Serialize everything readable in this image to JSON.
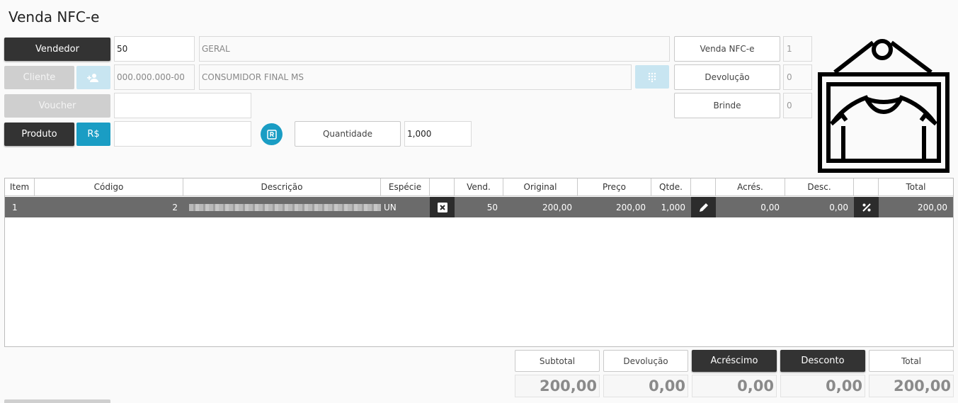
{
  "page": {
    "title": "Venda NFC-e"
  },
  "form": {
    "vendedor_label": "Vendedor",
    "vendedor_code": "50",
    "vendedor_name": "GERAL",
    "cliente_label": "Cliente",
    "cliente_doc": "000.000.000-00",
    "cliente_name": "CONSUMIDOR FINAL MS",
    "voucher_label": "Voucher",
    "voucher_value": "",
    "produto_label": "Produto",
    "price_button": "R$",
    "produto_value": "",
    "quantidade_label": "Quantidade",
    "quantidade_value": "1,000"
  },
  "side": {
    "venda_label": "Venda NFC-e",
    "venda_count": "1",
    "devolucao_label": "Devolução",
    "devolucao_count": "0",
    "brinde_label": "Brinde",
    "brinde_count": "0"
  },
  "grid": {
    "headers": [
      "Item",
      "Código",
      "Descrição",
      "Espécie",
      "",
      "Vend.",
      "Original",
      "Preço",
      "Qtde.",
      "",
      "Acrés.",
      "Desc.",
      "",
      "Total"
    ],
    "rows": [
      {
        "item": "1",
        "codigo": "2",
        "descricao": "",
        "especie": "UN",
        "vend": "50",
        "original": "200,00",
        "preco": "200,00",
        "qtde": "1,000",
        "acres": "0,00",
        "desc": "0,00",
        "total": "200,00"
      }
    ]
  },
  "totals": {
    "subtotal_label": "Subtotal",
    "subtotal_value": "200,00",
    "devolucao_label": "Devolução",
    "devolucao_value": "0,00",
    "acrescimo_label": "Acréscimo",
    "acrescimo_value": "0,00",
    "desconto_label": "Desconto",
    "desconto_value": "0,00",
    "total_label": "Total",
    "total_value": "200,00"
  },
  "icons": {
    "add_client": "add-user-icon",
    "keypad": "keypad-icon",
    "r_badge": "r-badge-icon",
    "remove": "close-icon",
    "edit": "pencil-icon",
    "percent": "percent-icon",
    "logo": "shirt-store-logo"
  },
  "colors": {
    "dark": "#333333",
    "blue": "#1a9dc4",
    "row": "#6b6b6b"
  }
}
